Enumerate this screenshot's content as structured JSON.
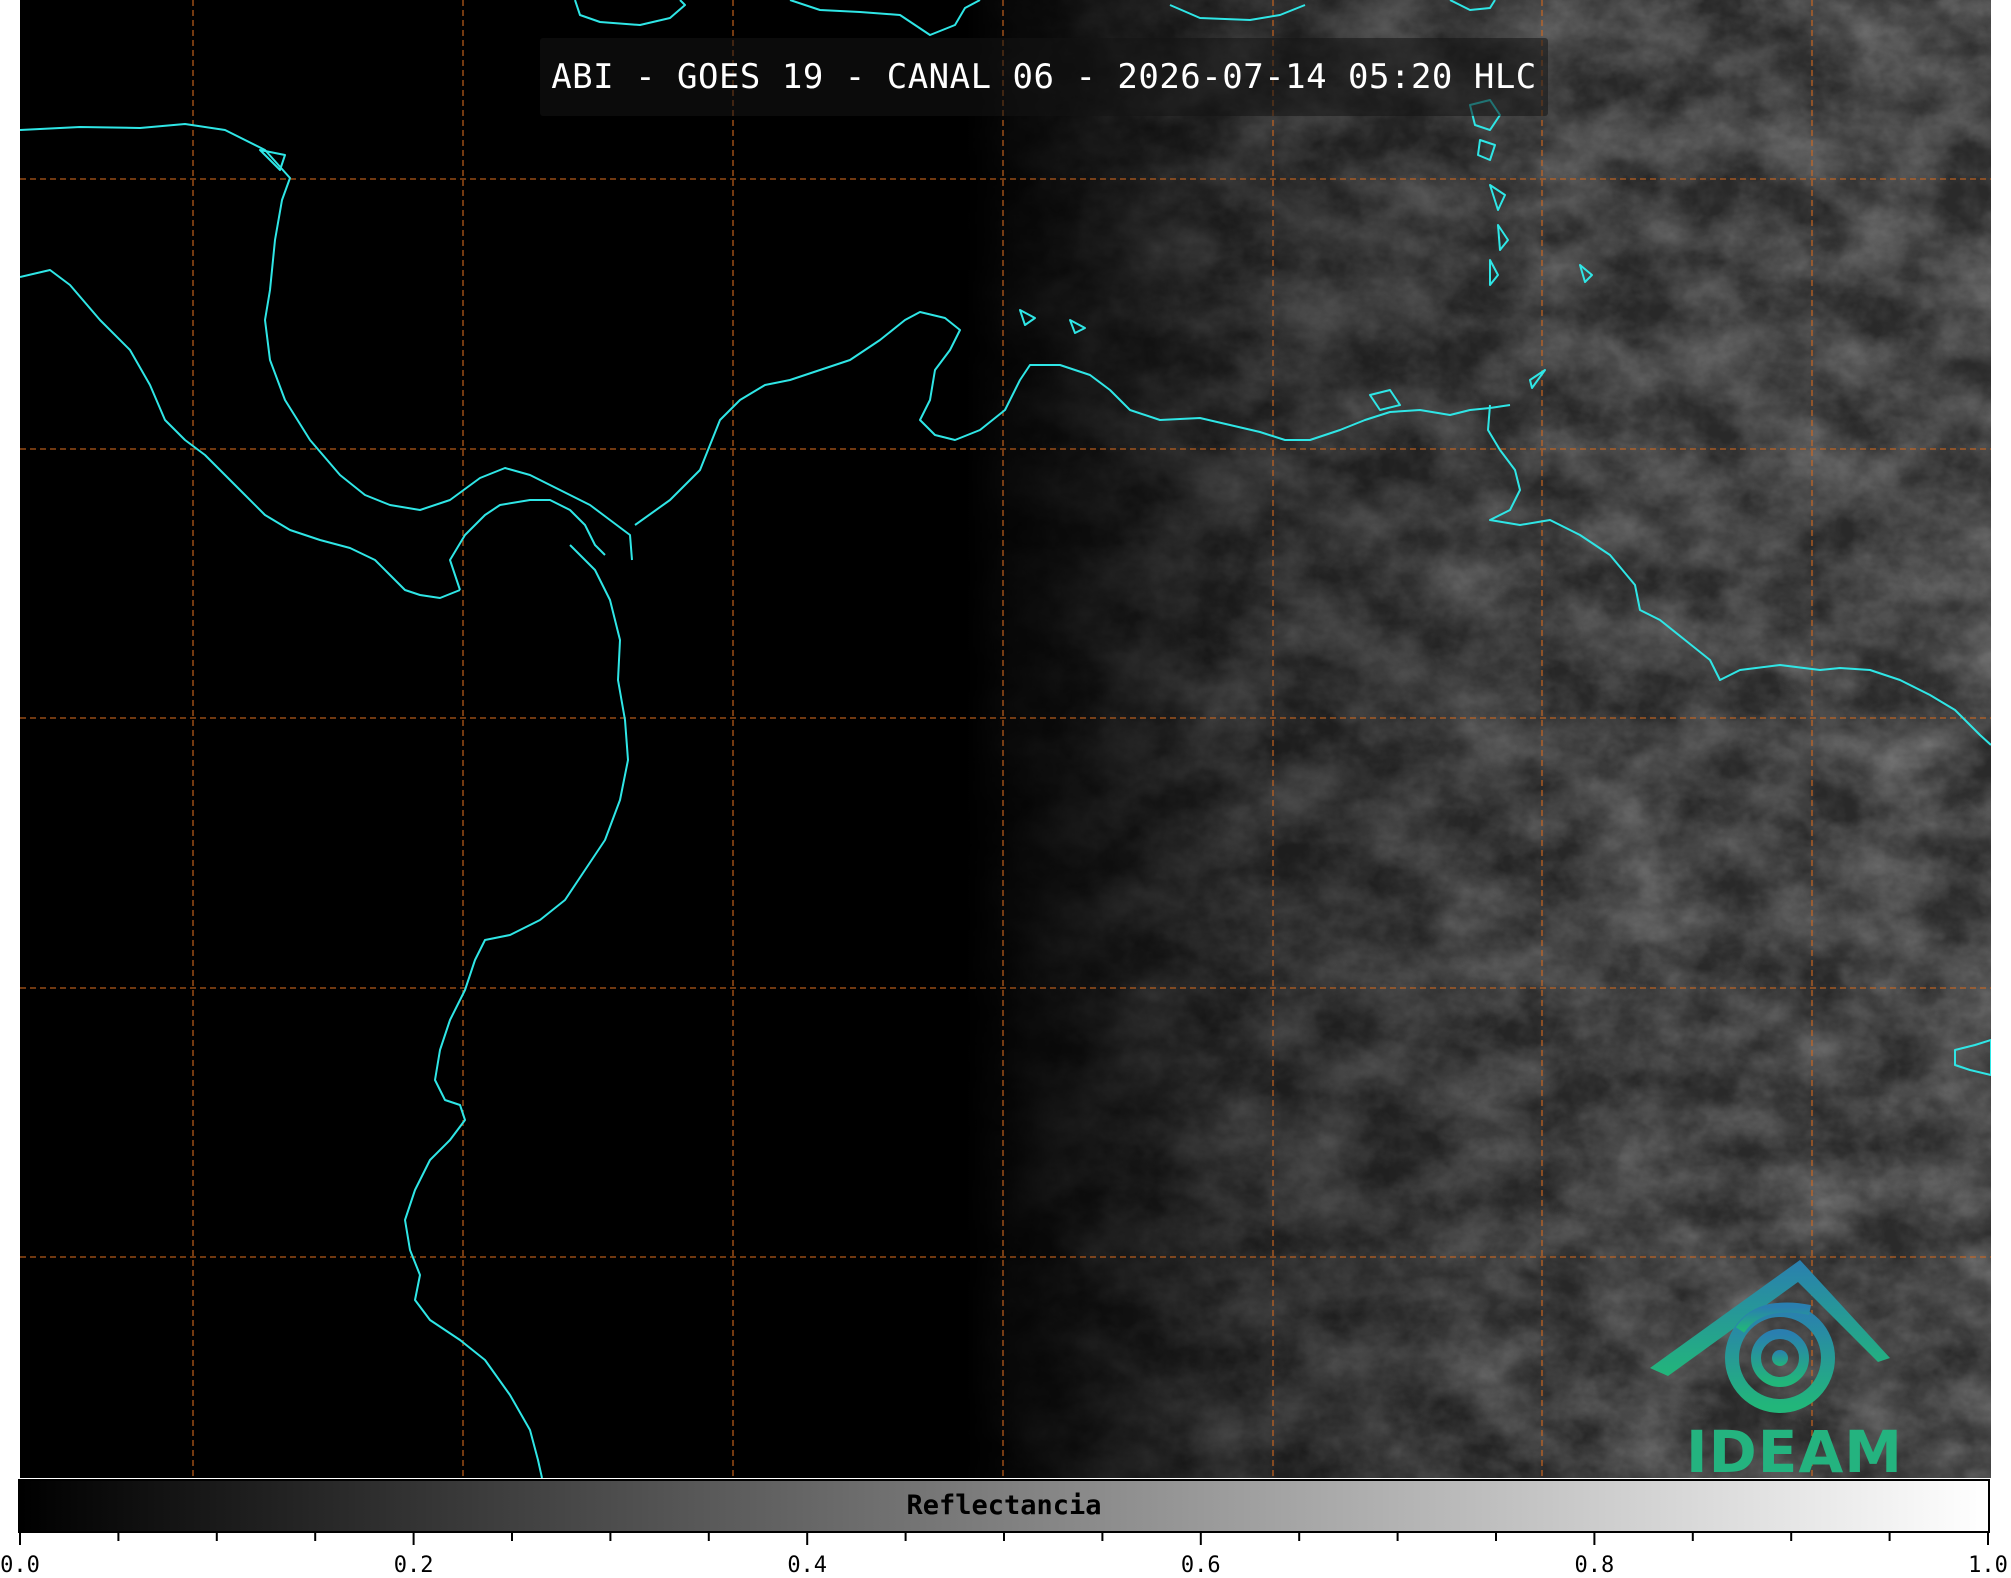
{
  "title": "ABI - GOES 19 - CANAL 06 - 2026-07-14 05:20 HLC",
  "logo": {
    "text": "IDEAM",
    "icon": "ideam-swirl-roof-logo",
    "color_top": "#2a7fb0",
    "color_bottom": "#22b67a"
  },
  "colorbar": {
    "label": "Reflectancia",
    "min": 0.0,
    "max": 1.0,
    "tick_labels": [
      "0.0",
      "0.2",
      "0.4",
      "0.6",
      "0.8",
      "1.0"
    ],
    "tick_values": [
      0.0,
      0.2,
      0.4,
      0.6,
      0.8,
      1.0
    ],
    "minor_step": 0.05,
    "color_min": "#000000",
    "color_max": "#ffffff"
  },
  "colors": {
    "coastline": "#2fe6e6",
    "gridline": "#d2691e",
    "background": "#000000"
  }
}
